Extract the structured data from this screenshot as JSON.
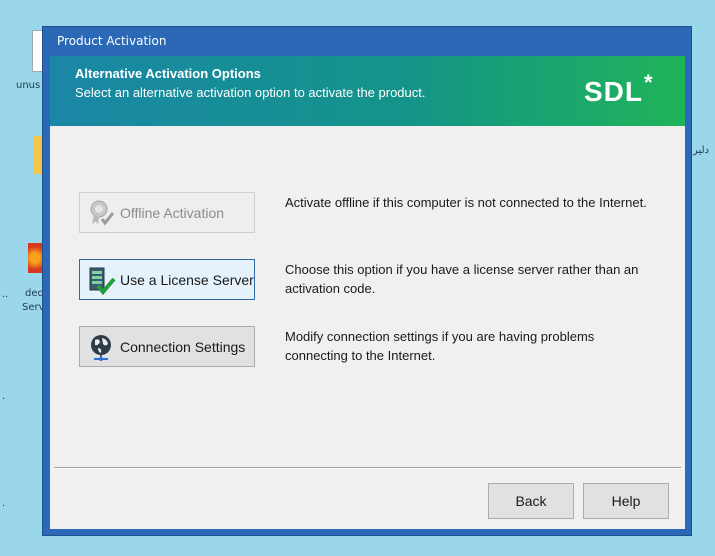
{
  "desktop": {
    "labels": [
      "unus",
      "ded",
      "Serv",
      "دلیر"
    ]
  },
  "window": {
    "title": "Product Activation"
  },
  "banner": {
    "title": "Alternative Activation Options",
    "subtitle": "Select an alternative activation option to activate the product.",
    "logo": "SDL",
    "logo_mark": "*"
  },
  "options": [
    {
      "label": "Offline Activation",
      "description": "Activate offline if this computer is not connected to the Internet.",
      "icon": "certificate-icon",
      "enabled": false
    },
    {
      "label": "Use a License Server",
      "description": "Choose this option if you have a license server rather than an activation code.",
      "icon": "license-server-icon",
      "enabled": true
    },
    {
      "label": "Connection Settings",
      "description": "Modify connection settings if you are having problems connecting to the Internet.",
      "icon": "globe-network-icon",
      "enabled": true
    }
  ],
  "footer": {
    "back_label": "Back",
    "help_label": "Help"
  },
  "colors": {
    "title_bar": "#2b68b5",
    "banner_start": "#1a87a6",
    "banner_end": "#1fb458",
    "dialog_bg": "#f0f0f0",
    "desktop_bg": "#9ad7ea"
  }
}
